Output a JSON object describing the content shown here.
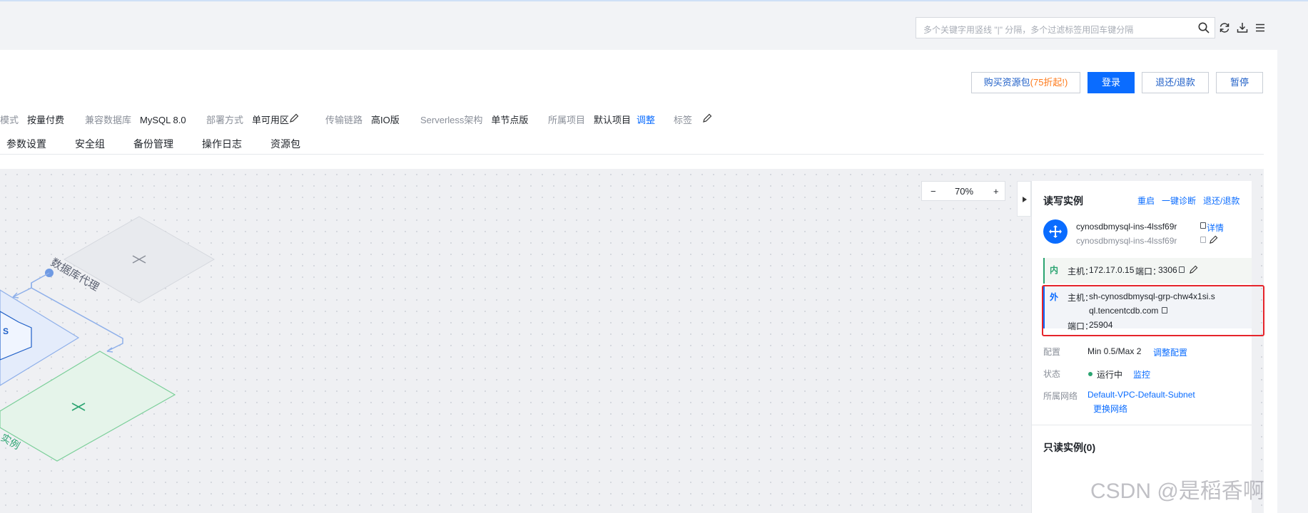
{
  "search": {
    "placeholder": "多个关键字用竖线 \"|\" 分隔，多个过滤标签用回车键分隔"
  },
  "toolbar_icons": [
    "search-icon",
    "refresh-icon",
    "download-icon",
    "menu-icon"
  ],
  "actions": {
    "buy_pkg": "购买资源包",
    "buy_pkg_highlight": "(75折起!)",
    "login": "登录",
    "refund": "退还/退款",
    "pause": "暂停"
  },
  "meta": [
    {
      "label": "模式",
      "value": "按量付费"
    },
    {
      "label": "兼容数据库",
      "value": "MySQL 8.0"
    },
    {
      "label": "部署方式",
      "value": "单可用区"
    },
    {
      "label": "传输链路",
      "value": "高IO版"
    },
    {
      "label": "Serverless架构",
      "value": "单节点版"
    },
    {
      "label": "所属项目",
      "value": "默认项目",
      "link": "调整"
    },
    {
      "label": "标签",
      "value": ""
    }
  ],
  "tabs": [
    "参数设置",
    "安全组",
    "备份管理",
    "操作日志",
    "资源包"
  ],
  "zoom": {
    "minus": "−",
    "level": "70%",
    "plus": "+"
  },
  "diagram": {
    "proxy_label": "数据库代理",
    "instance_label_partial": "实例",
    "node_text": "S"
  },
  "side": {
    "title": "读写实例",
    "actions": [
      "重启",
      "一键诊断",
      "退还/退款"
    ],
    "instance_id": "cynosdbmysql-ins-4lssf69r",
    "instance_name": "cynosdbmysql-ins-4lssf69r",
    "detail_link": "详情",
    "inner": {
      "tag": "内",
      "host_label": "主机：",
      "host": "172.17.0.15",
      "port_label": "端口：",
      "port": "3306"
    },
    "outer": {
      "tag": "外",
      "host_label": "主机：",
      "host_line1": "sh-cynosdbmysql-grp-chw4x1si.s",
      "host_line2": "ql.tencentcdb.com",
      "port_label": "端口：",
      "port": "25904"
    },
    "config": {
      "label": "配置",
      "value": "Min 0.5/Max 2",
      "link": "调整配置"
    },
    "status": {
      "label": "状态",
      "value": "运行中",
      "link": "监控",
      "color": "#2ba471"
    },
    "network": {
      "label": "所属网络",
      "value": "Default-VPC-Default-Subnet",
      "link": "更换网络"
    },
    "readonly": "只读实例(0)"
  },
  "watermark": "CSDN @是稻香啊"
}
